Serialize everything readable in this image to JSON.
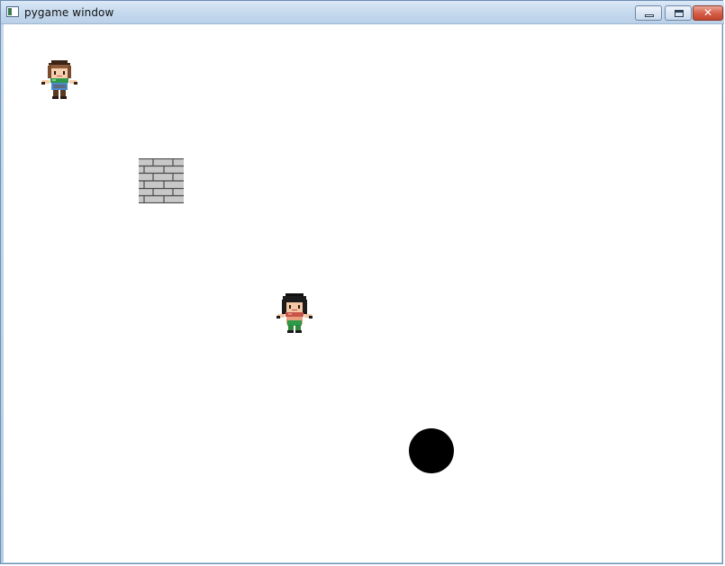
{
  "window": {
    "title": "pygame window",
    "controls": {
      "minimize": "minimize-icon",
      "maximize": "maximize-icon",
      "close": "close-icon",
      "close_glyph": "✕"
    }
  },
  "scene": {
    "background": "#ffffff",
    "objects": [
      {
        "kind": "character",
        "variant": "brown-hair-green-scarf"
      },
      {
        "kind": "brick-wall-tile",
        "color": "#c8c8c8"
      },
      {
        "kind": "character",
        "variant": "black-hair-red-scarf"
      },
      {
        "kind": "ball",
        "color": "#000000"
      }
    ]
  }
}
